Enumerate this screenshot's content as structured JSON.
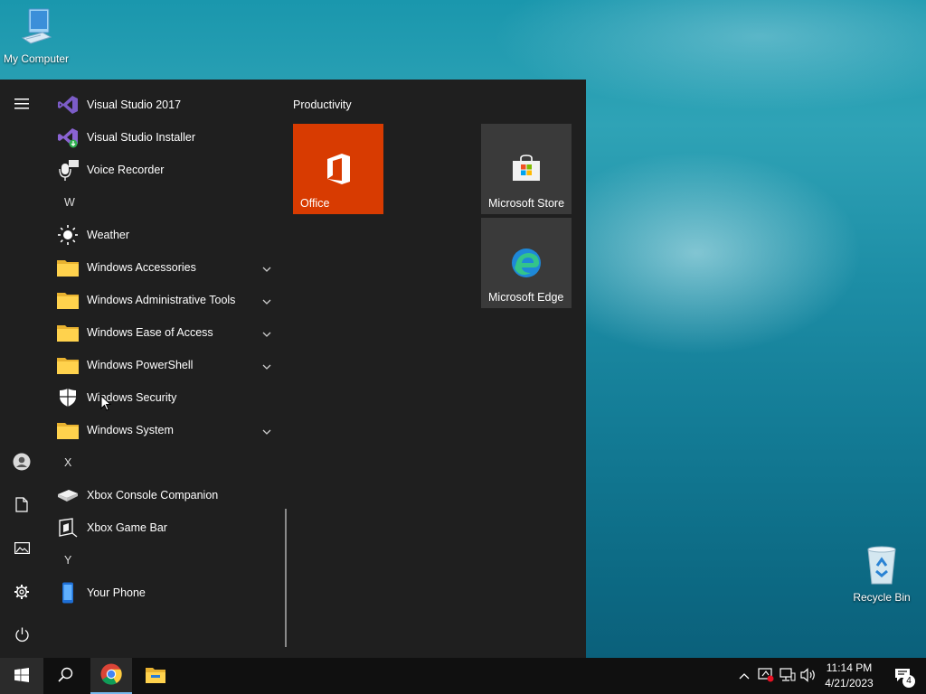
{
  "desktop": {
    "icons": [
      {
        "label": "My Computer",
        "icon": "computer-icon"
      },
      {
        "label": "Recycle Bin",
        "icon": "recycle-bin-icon"
      }
    ]
  },
  "start_menu": {
    "rail": [
      "hamburger-icon",
      "user-icon",
      "document-icon",
      "pictures-icon",
      "settings-icon",
      "power-icon"
    ],
    "apps": [
      {
        "label": "Visual Studio 2017",
        "icon": "visual-studio-icon"
      },
      {
        "label": "Visual Studio Installer",
        "icon": "visual-studio-installer-icon"
      },
      {
        "label": "Voice Recorder",
        "icon": "microphone-icon"
      },
      {
        "letter": "W"
      },
      {
        "label": "Weather",
        "icon": "sun-icon"
      },
      {
        "label": "Windows Accessories",
        "icon": "folder-icon",
        "expandable": true
      },
      {
        "label": "Windows Administrative Tools",
        "icon": "folder-icon",
        "expandable": true
      },
      {
        "label": "Windows Ease of Access",
        "icon": "folder-icon",
        "expandable": true
      },
      {
        "label": "Windows PowerShell",
        "icon": "folder-icon",
        "expandable": true
      },
      {
        "label": "Windows Security",
        "icon": "shield-icon"
      },
      {
        "label": "Windows System",
        "icon": "folder-icon",
        "expandable": true
      },
      {
        "letter": "X"
      },
      {
        "label": "Xbox Console Companion",
        "icon": "xbox-console-icon"
      },
      {
        "label": "Xbox Game Bar",
        "icon": "xbox-game-bar-icon"
      },
      {
        "letter": "Y"
      },
      {
        "label": "Your Phone",
        "icon": "phone-icon"
      }
    ],
    "group_title": "Productivity",
    "tiles": {
      "office": {
        "label": "Office",
        "color": "#d83b01",
        "icon": "office-icon"
      },
      "store": {
        "label": "Microsoft Store",
        "icon": "store-icon"
      },
      "edge": {
        "label": "Microsoft Edge",
        "icon": "edge-icon"
      }
    }
  },
  "taskbar": {
    "pinned": [
      "windows-start-icon",
      "search-icon",
      "chrome-icon",
      "file-explorer-icon"
    ],
    "tray": [
      "chevron-up-icon",
      "security-alert-icon",
      "network-icon",
      "volume-icon"
    ],
    "time": "11:14 PM",
    "date": "4/21/2023",
    "notification_count": "4"
  },
  "colors": {
    "accent": "#d83b01",
    "menu_bg": "#1f1f1f",
    "tile_bg": "#3a3a3a",
    "taskbar_bg": "#101010"
  }
}
